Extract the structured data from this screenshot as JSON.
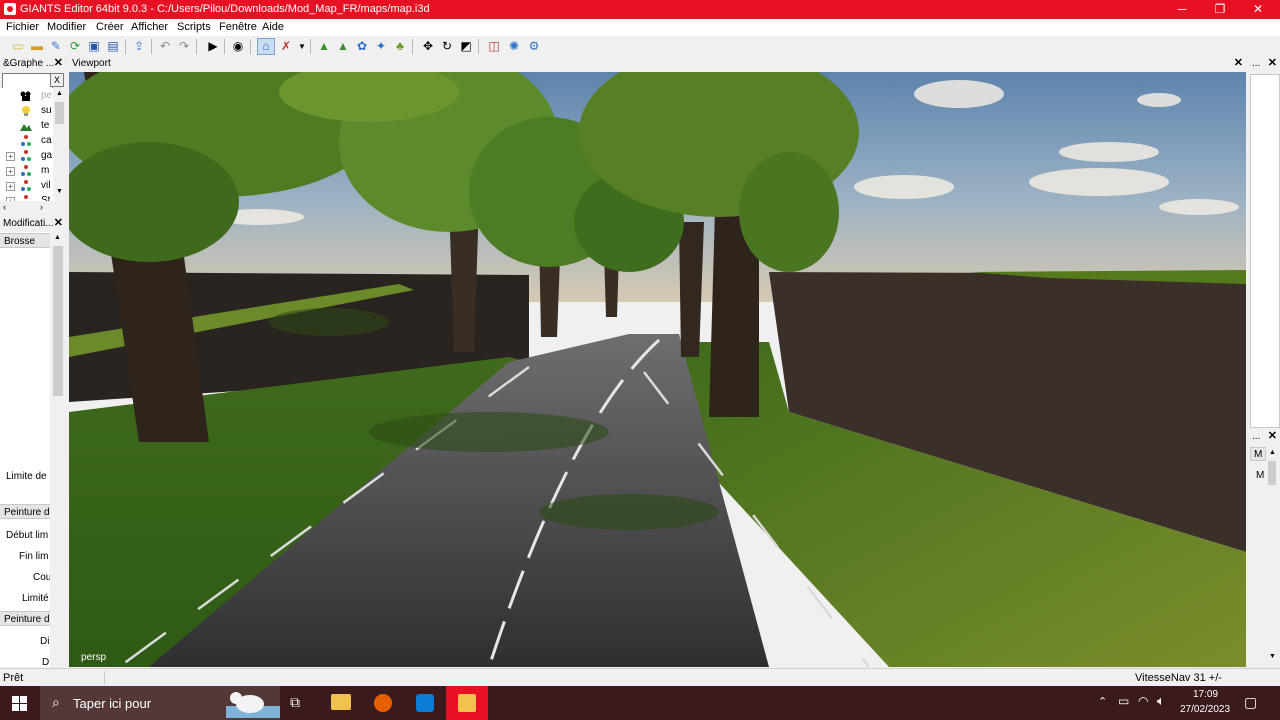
{
  "window": {
    "title": "GIANTS Editor 64bit 9.0.3 - C:/Users/Pilou/Downloads/Mod_Map_FR/maps/map.i3d",
    "minimize": "─",
    "restore": "❐",
    "close": "✕"
  },
  "menu": [
    "Fichier",
    "Modifier",
    "Créer",
    "Afficher",
    "Scripts",
    "Fenêtre",
    "Aide"
  ],
  "scene_panel": {
    "title": "&Graphe ...",
    "close": "✕",
    "search_clear": "X",
    "items": [
      {
        "label": "pe",
        "icon": "camera-icon",
        "expand": ""
      },
      {
        "label": "su",
        "icon": "lightbulb-icon",
        "expand": ""
      },
      {
        "label": "te",
        "icon": "terrain-icon",
        "expand": ""
      },
      {
        "label": "ca",
        "icon": "transform-group-icon",
        "expand": ""
      },
      {
        "label": "ga",
        "icon": "transform-group-icon",
        "expand": "+"
      },
      {
        "label": "m",
        "icon": "transform-group-icon",
        "expand": "+"
      },
      {
        "label": "vil",
        "icon": "transform-group-icon",
        "expand": "+"
      },
      {
        "label": "St",
        "icon": "transform-group-icon",
        "expand": "+"
      }
    ]
  },
  "modifier_panel": {
    "title": "Modificati...",
    "close": "✕",
    "sections": [
      "Brosse",
      "Peinture d",
      "Peinture d"
    ],
    "labels": [
      "Limite de",
      "Début lim",
      "Fin lim",
      "Cou",
      "Limité",
      "Di",
      "D"
    ]
  },
  "viewport": {
    "title": "Viewport",
    "close": "✕",
    "camera_label": "persp"
  },
  "right_panels": {
    "top_title": "...",
    "top_close": "✕",
    "bottom_title": "...",
    "bottom_close": "✕",
    "bottom_tab": "M",
    "bottom_label": "M"
  },
  "status": {
    "left": "Prêt",
    "right": "VitesseNav 31 +/-"
  },
  "taskbar": {
    "search_placeholder": "Taper ici pour",
    "time": "17:09",
    "date": "27/02/2023"
  },
  "colors": {
    "titlebar": "#e81123",
    "taskbar": "#3a1a1a",
    "sky_top": "#6b8fb5",
    "grass": "#4e7a22",
    "road": "#3c3c3e"
  }
}
